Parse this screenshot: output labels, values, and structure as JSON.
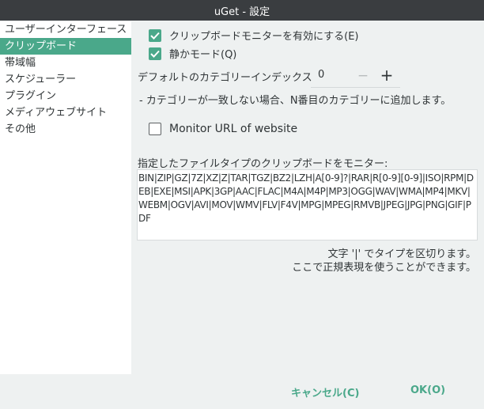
{
  "window": {
    "title": "uGet - 設定"
  },
  "sidebar": {
    "items": [
      {
        "label": "ユーザーインターフェース",
        "selected": false
      },
      {
        "label": "クリップボード",
        "selected": true
      },
      {
        "label": "帯域幅",
        "selected": false
      },
      {
        "label": "スケジューラー",
        "selected": false
      },
      {
        "label": "プラグイン",
        "selected": false
      },
      {
        "label": "メディアウェブサイト",
        "selected": false
      },
      {
        "label": "その他",
        "selected": false
      }
    ]
  },
  "clipboard": {
    "monitor_checkbox": {
      "label": "クリップボードモニターを有効にする(E)",
      "checked": true
    },
    "quiet_checkbox": {
      "label": "静かモード(Q)",
      "checked": true
    },
    "default_category": {
      "label": "デフォルトのカテゴリーインデックス",
      "value": "0",
      "minus": "−",
      "plus": "+"
    },
    "note": "- カテゴリーが一致しない場合、N番目のカテゴリーに追加します。",
    "monitor_url_checkbox": {
      "label": "Monitor URL of website",
      "checked": false
    },
    "filetypes_label": "指定したファイルタイプのクリップボードをモニター:",
    "filetypes_value": "BIN|ZIP|GZ|7Z|XZ|Z|TAR|TGZ|BZ2|LZH|A[0-9]?|RAR|R[0-9][0-9]|ISO|RPM|DEB|EXE|MSI|APK|3GP|AAC|FLAC|M4A|M4P|MP3|OGG|WAV|WMA|MP4|MKV|WEBM|OGV|AVI|MOV|WMV|FLV|F4V|MPG|MPEG|RMVB|JPEG|JPG|PNG|GIF|PDF",
    "hint_line1": "文字 '|' でタイプを区切ります。",
    "hint_line2": "ここで正規表現を使うことができます。"
  },
  "buttons": {
    "cancel": "キャンセル(C)",
    "ok": "OK(O)"
  },
  "colors": {
    "accent": "#4aa88a",
    "titlebar": "#3a3d40",
    "background": "#eef1f1"
  }
}
